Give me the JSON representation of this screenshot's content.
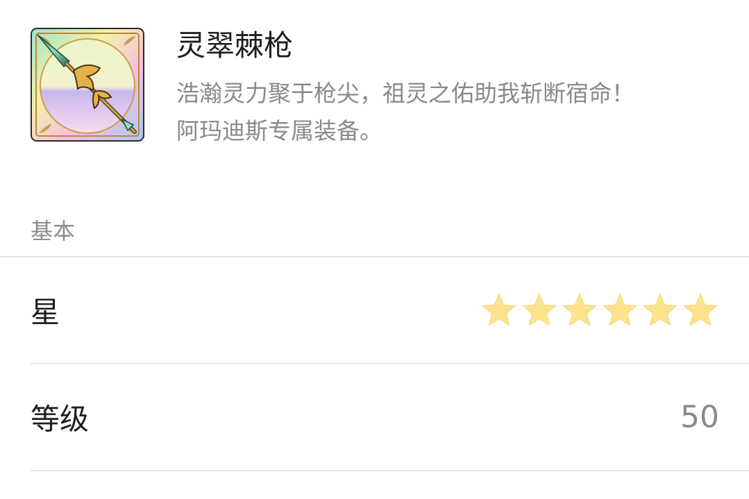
{
  "item": {
    "name": "灵翠棘枪",
    "description_lines": [
      "浩瀚灵力聚于枪尖，祖灵之佑助我斩断宿命！",
      "阿玛迪斯专属装备。"
    ],
    "icon": "spear-icon"
  },
  "section": {
    "title": "基本"
  },
  "rows": {
    "star": {
      "label": "星",
      "value": 6,
      "max": 6,
      "icon": "star-icon",
      "color": "#fde38c"
    },
    "level": {
      "label": "等级",
      "value": "50"
    }
  }
}
